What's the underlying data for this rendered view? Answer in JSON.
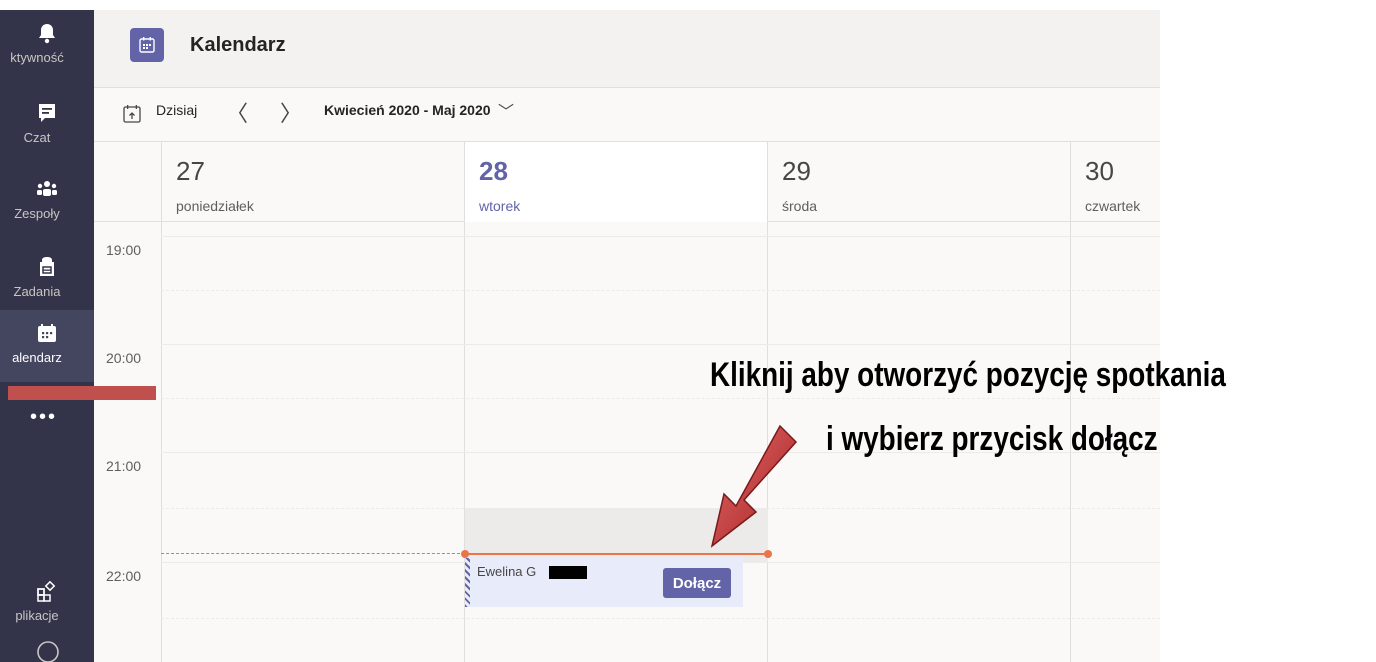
{
  "rail": {
    "items": [
      {
        "label": "ktywność",
        "icon": "bell-icon"
      },
      {
        "label": "Czat",
        "icon": "chat-icon"
      },
      {
        "label": "Zespoły",
        "icon": "teams-icon"
      },
      {
        "label": "Zadania",
        "icon": "assignments-icon"
      },
      {
        "label": "alendarz",
        "icon": "calendar-icon"
      },
      {
        "label": "plikacje",
        "icon": "apps-icon"
      }
    ],
    "more": "•••"
  },
  "header": {
    "title": "Kalendarz"
  },
  "toolbar": {
    "today": "Dzisiaj",
    "prev": "〈",
    "next": "〉",
    "range": "Kwiecień 2020 - Maj 2020",
    "range_chevron": "﹀"
  },
  "days": [
    {
      "num": "27",
      "name": "poniedziałek"
    },
    {
      "num": "28",
      "name": "wtorek"
    },
    {
      "num": "29",
      "name": "środa"
    },
    {
      "num": "30",
      "name": "czwartek"
    }
  ],
  "times": [
    "19:00",
    "20:00",
    "21:00",
    "22:00"
  ],
  "event": {
    "title": "Ewelina G",
    "join": "Dołącz"
  },
  "annotation": {
    "line1": "Kliknij aby otworzyć pozycję spotkania",
    "line2": "i wybierz przycisk dołącz"
  },
  "colors": {
    "rail": "#33344a",
    "accent": "#6264a7",
    "now": "#e97548",
    "marker": "#c0504d"
  }
}
